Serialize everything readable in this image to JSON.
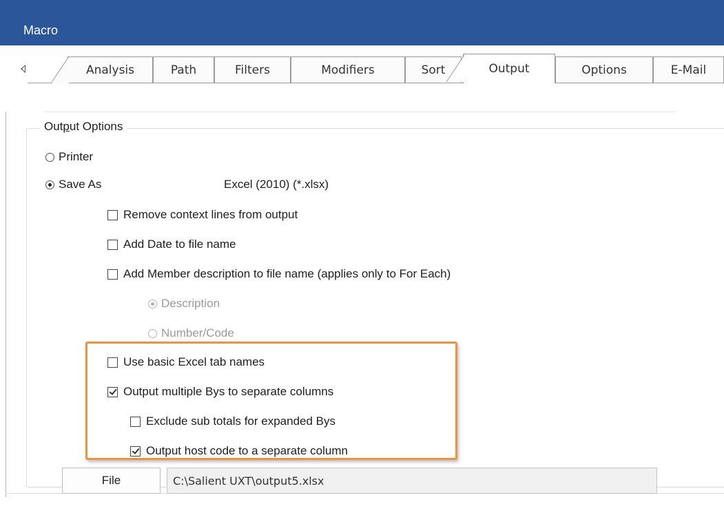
{
  "window": {
    "title": "Macro"
  },
  "tabs": [
    {
      "label": "Analysis"
    },
    {
      "label": "Path"
    },
    {
      "label": "Filters"
    },
    {
      "label": "Modifiers"
    },
    {
      "label": "Sort"
    },
    {
      "label": "Output",
      "active": true
    },
    {
      "label": "Options"
    },
    {
      "label": "E-Mail"
    }
  ],
  "output_options": {
    "group_label_pre": "Out",
    "group_label_mnemonic": "p",
    "group_label_post": "ut Options",
    "printer_label": "Printer",
    "printer_selected": false,
    "save_as_label": "Save As",
    "save_as_selected": true,
    "format_value": "Excel (2010) (*.xlsx)",
    "remove_context_label": "Remove context lines from output",
    "remove_context_checked": false,
    "add_date_label": "Add Date to file name",
    "add_date_checked": false,
    "add_member_desc_label": "Add Member description to file name (applies only to For Each)",
    "add_member_desc_checked": false,
    "description_label": "Description",
    "description_selected": true,
    "number_code_label": "Number/Code",
    "number_code_selected": false,
    "basic_tab_names_label": "Use basic Excel tab names",
    "basic_tab_names_checked": false,
    "multiple_bys_label": "Output multiple Bys to separate columns",
    "multiple_bys_checked": true,
    "exclude_subtotals_label": "Exclude sub totals for expanded Bys",
    "exclude_subtotals_checked": false,
    "host_code_label": "Output host code to a separate column",
    "host_code_checked": true
  },
  "file": {
    "button_label": "File",
    "path_value": "C:\\Salient UXT\\output5.xlsx"
  },
  "colors": {
    "titlebar": "#2b579a",
    "highlight": "#f0923a"
  }
}
